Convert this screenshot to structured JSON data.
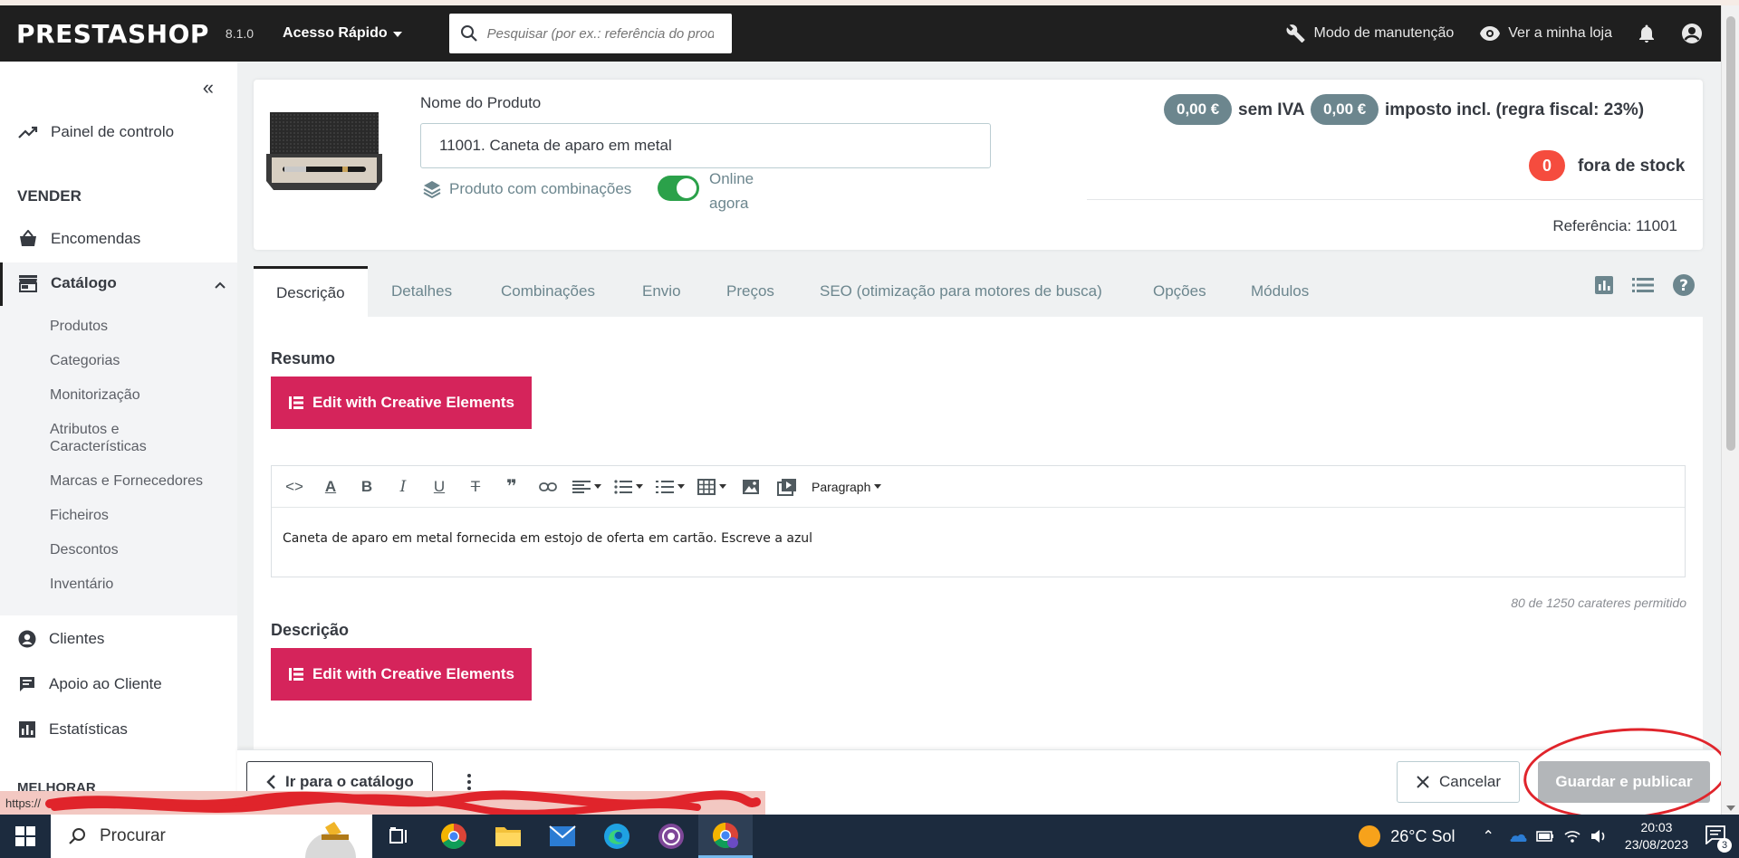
{
  "header": {
    "logo": "PRESTASHOP",
    "version": "8.1.0",
    "quick_access": "Acesso Rápido",
    "search_placeholder": "Pesquisar (por ex.: referência do produto)",
    "maintenance": "Modo de manutenção",
    "view_store": "Ver a minha loja"
  },
  "sidebar": {
    "dashboard": "Painel de controlo",
    "sell_heading": "VENDER",
    "orders": "Encomendas",
    "catalog": "Catálogo",
    "catalog_items": [
      "Produtos",
      "Categorias",
      "Monitorização",
      "Atributos e Características",
      "Marcas e Fornecedores",
      "Ficheiros",
      "Descontos",
      "Inventário"
    ],
    "customers": "Clientes",
    "support": "Apoio ao Cliente",
    "stats": "Estatísticas",
    "improve_heading": "MELHORAR"
  },
  "product": {
    "name_label": "Nome do Produto",
    "name_value": "11001. Caneta de aparo em metal",
    "combinations": "Produto com combinações",
    "online_line1": "Online",
    "online_line2": "agora",
    "price_excl": "0,00 €",
    "price_excl_label": "sem IVA",
    "price_incl": "0,00 €",
    "price_incl_label": "imposto incl. (regra fiscal: 23%)",
    "stock_qty": "0",
    "stock_label": "fora de stock",
    "reference": "Referência: 11001"
  },
  "tabs": [
    "Descrição",
    "Detalhes",
    "Combinações",
    "Envio",
    "Preços",
    "SEO (otimização para motores de busca)",
    "Opções",
    "Módulos"
  ],
  "content": {
    "summary_title": "Resumo",
    "ce_button": "Edit with Creative Elements",
    "paragraph": "Paragraph",
    "summary_text": "Caneta de aparo em metal fornecida em estojo de oferta em cartão. Escreve a azul",
    "counter": "80 de 1250 carateres permitido",
    "description_title": "Descrição"
  },
  "footer": {
    "back_catalog": "Ir para o catálogo",
    "cancel": "Cancelar",
    "save_publish": "Guardar e publicar"
  },
  "status_url": "https://",
  "taskbar": {
    "search": "Procurar",
    "weather": "26°C  Sol",
    "time": "20:03",
    "date": "23/08/2023",
    "notifications": "3"
  },
  "colors": {
    "accent": "#d5245b",
    "header": "#1f1f1f",
    "badge": "#6c868e",
    "danger": "#f54c3e",
    "success": "#2ba14a"
  }
}
